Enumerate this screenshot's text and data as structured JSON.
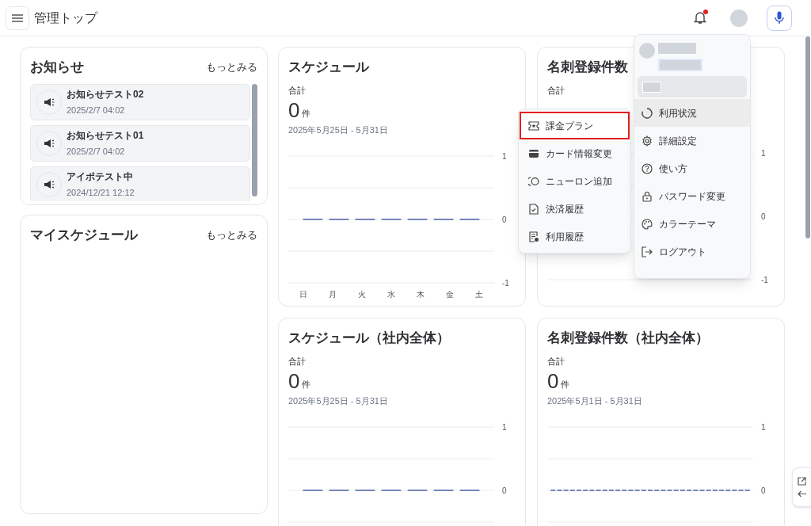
{
  "header": {
    "title": "管理トップ",
    "notification_dot": true
  },
  "news": {
    "title": "お知らせ",
    "more": "もっとみる",
    "items": [
      {
        "title": "お知らせテスト02",
        "date": "2025/2/7 04:02"
      },
      {
        "title": "お知らせテスト01",
        "date": "2025/2/7 04:02"
      },
      {
        "title": "アイポテスト中",
        "date": "2024/12/21 12:12"
      }
    ]
  },
  "my_schedule": {
    "title": "マイスケジュール",
    "more": "もっとみる"
  },
  "stat_cards": [
    {
      "title": "スケジュール",
      "total_label": "合計",
      "count": "0",
      "unit": "件",
      "date_range": "2025年5月25日 - 5月31日",
      "chart_data": {
        "type": "line",
        "categories": [
          "日",
          "月",
          "火",
          "水",
          "木",
          "金",
          "土"
        ],
        "series": [
          {
            "color": "#4a62a8",
            "line_style": "dashed",
            "values": [
              0,
              0,
              0,
              0,
              0,
              0,
              0
            ]
          }
        ],
        "ylim": [
          -1,
          1
        ],
        "yticks": [
          -1,
          0,
          1
        ]
      }
    },
    {
      "title": "名刺登録件数",
      "total_label": "合計",
      "y_tick_labels": [
        "1",
        "0",
        "-1"
      ]
    },
    {
      "title": "スケジュール（社内全体）",
      "total_label": "合計",
      "count": "0",
      "unit": "件",
      "date_range": "2025年5月25日 - 5月31日",
      "chart_data": {
        "type": "line",
        "categories": [
          null,
          null,
          null,
          null,
          null,
          null,
          null
        ],
        "series": [
          {
            "color": "#4a62a8",
            "line_style": "dashed",
            "values": [
              0,
              0,
              0,
              0,
              0,
              0,
              0
            ]
          }
        ],
        "ylim": [
          -0.5,
          1
        ],
        "yticks": [
          0,
          1
        ]
      }
    },
    {
      "title": "名刺登録件数（社内全体）",
      "total_label": "合計",
      "count": "0",
      "unit": "件",
      "date_range": "2025年5月1日 - 5月31日",
      "chart_data": {
        "type": "line",
        "categories": [
          null,
          null,
          null,
          null,
          null,
          null,
          null,
          null,
          null,
          null,
          null,
          null,
          null,
          null,
          null,
          null,
          null,
          null,
          null,
          null,
          null,
          null,
          null,
          null,
          null,
          null,
          null,
          null,
          null,
          null,
          null
        ],
        "series": [
          {
            "color": "#4a62a8",
            "line_style": "dashed",
            "values": [
              0,
              0,
              0,
              0,
              0,
              0,
              0,
              0,
              0,
              0,
              0,
              0,
              0,
              0,
              0,
              0,
              0,
              0,
              0,
              0,
              0,
              0,
              0,
              0,
              0,
              0,
              0,
              0,
              0,
              0,
              0
            ]
          }
        ],
        "ylim": [
          -0.5,
          1
        ],
        "yticks": [
          0,
          1
        ]
      }
    }
  ],
  "submenu": {
    "items": [
      {
        "label": "課金プラン",
        "selected": true
      },
      {
        "label": "カード情報変更",
        "selected": false
      },
      {
        "label": "ニューロン追加",
        "selected": false
      },
      {
        "label": "決済履歴",
        "selected": false
      },
      {
        "label": "利用履歴",
        "selected": false
      }
    ]
  },
  "user_menu": {
    "items": [
      {
        "label": "利用状況",
        "selected": true
      },
      {
        "label": "詳細設定",
        "selected": false
      },
      {
        "label": "使い方",
        "selected": false
      },
      {
        "label": "パスワード変更",
        "selected": false
      },
      {
        "label": "カラーテーマ",
        "selected": false
      },
      {
        "label": "ログアウト",
        "selected": false
      }
    ]
  }
}
